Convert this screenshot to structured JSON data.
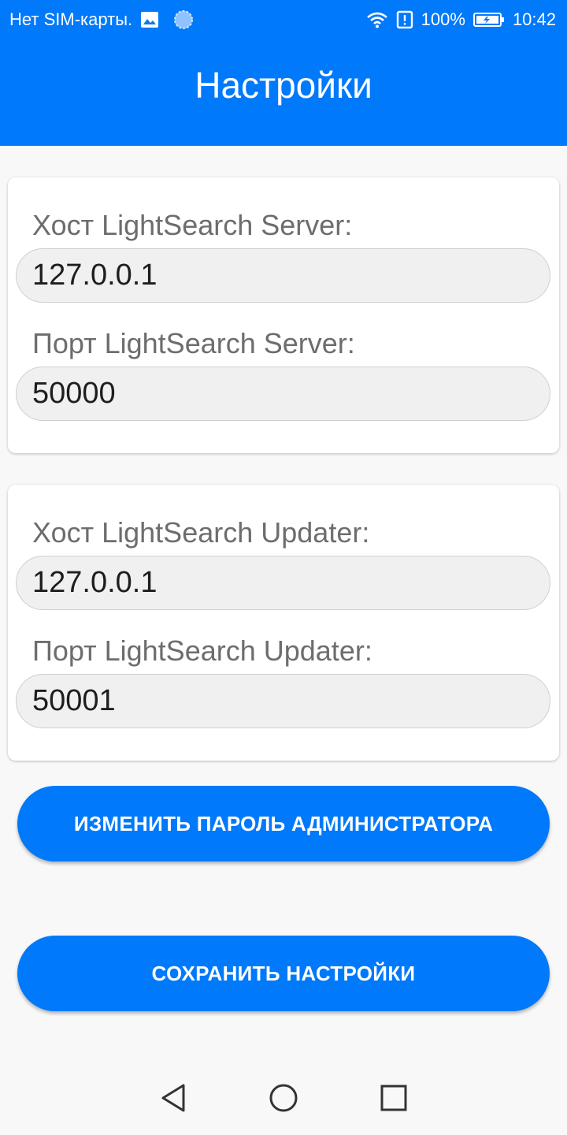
{
  "status_bar": {
    "carrier": "Нет SIM-карты.",
    "battery": "100%",
    "time": "10:42",
    "icons": [
      "image-icon",
      "sync-icon",
      "wifi-icon",
      "alert-icon",
      "battery-icon"
    ]
  },
  "app_bar": {
    "title": "Настройки"
  },
  "server_card": {
    "host_label": "Хост LightSearch Server:",
    "host_value": "127.0.0.1",
    "port_label": "Порт LightSearch Server:",
    "port_value": "50000"
  },
  "updater_card": {
    "host_label": "Хост LightSearch Updater:",
    "host_value": "127.0.0.1",
    "port_label": "Порт LightSearch Updater:",
    "port_value": "50001"
  },
  "buttons": {
    "change_admin_password": "ИЗМЕНИТЬ ПАРОЛЬ АДМИНИСТРАТОРА",
    "save_settings": "СОХРАНИТЬ НАСТРОЙКИ"
  },
  "nav_bar": {
    "icons": [
      "back-icon",
      "home-icon",
      "recents-icon"
    ]
  },
  "colors": {
    "accent": "#0079fb",
    "background": "#f8f8f8",
    "card": "#ffffff",
    "input_bg": "#f0f0f0",
    "label": "#6d6d6d"
  }
}
